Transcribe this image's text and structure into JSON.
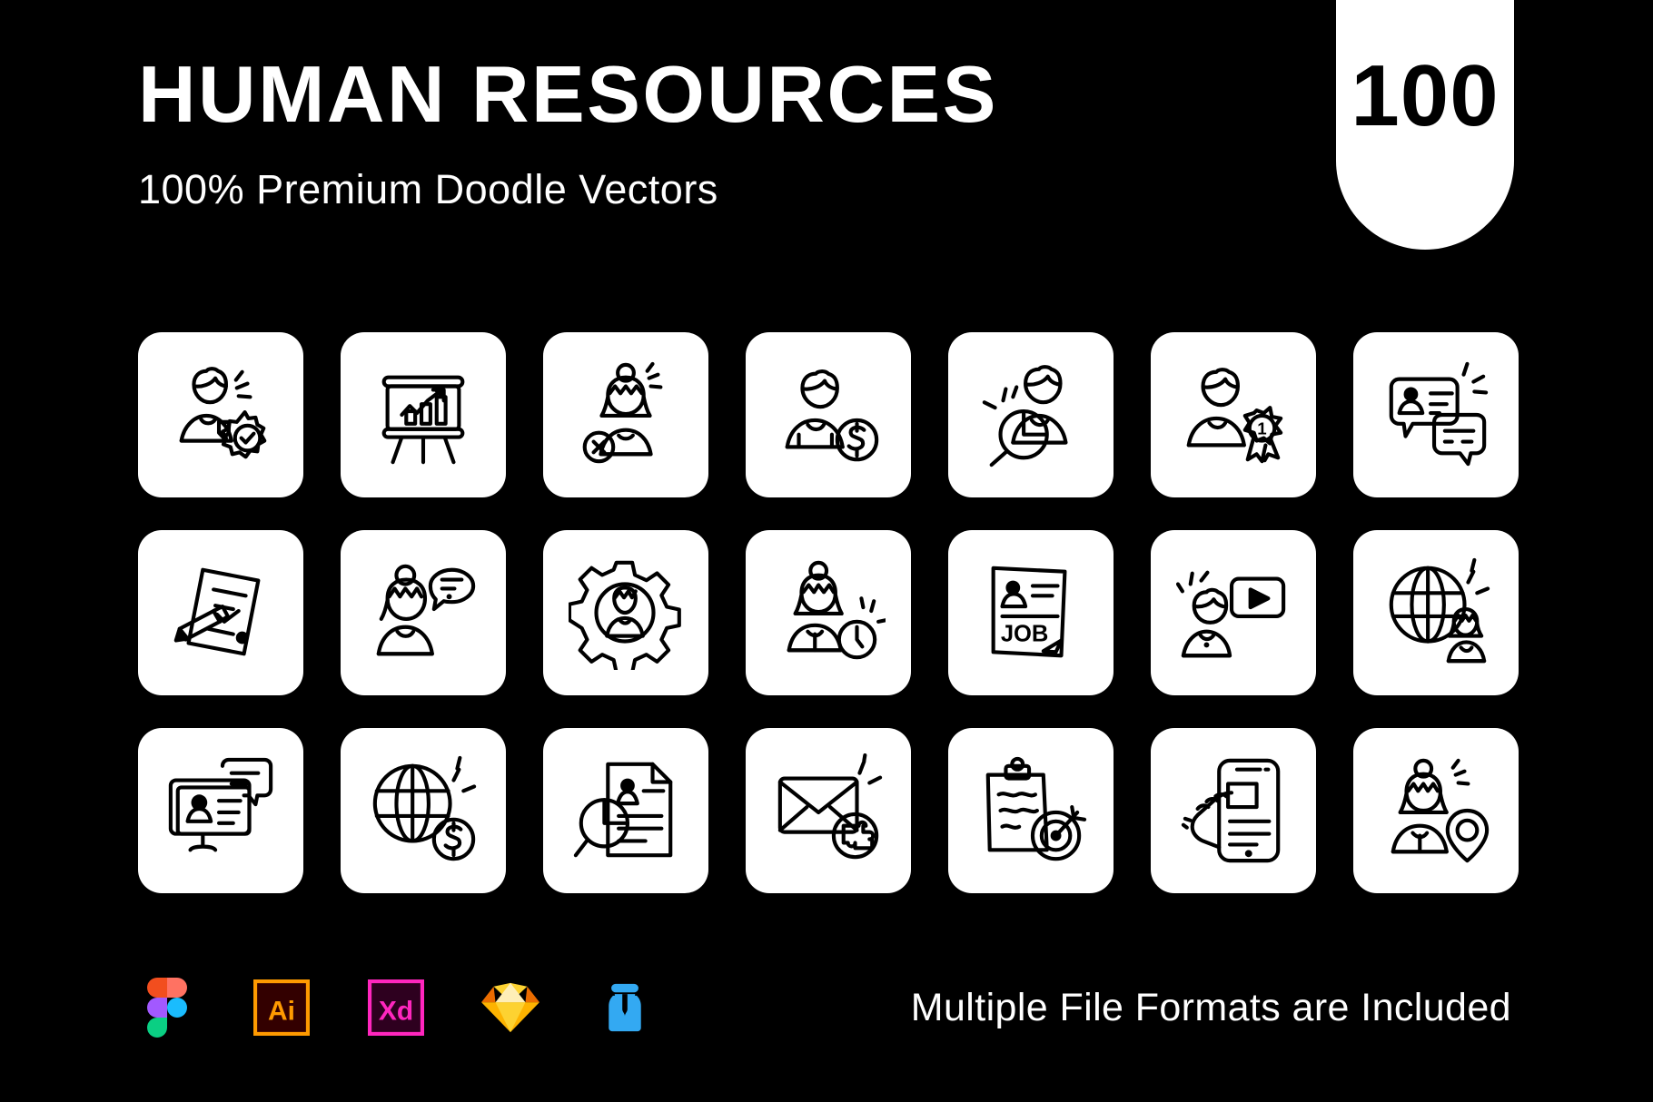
{
  "badge": {
    "count": "100"
  },
  "header": {
    "title": "HUMAN RESOURCES",
    "subtitle": "100% Premium Doodle Vectors"
  },
  "colors": {
    "background": "#000000",
    "tile": "#ffffff",
    "stroke": "#000000",
    "text": "#ffffff",
    "figma_red": "#f24e1e",
    "figma_orange": "#ff7262",
    "figma_purple": "#a259ff",
    "figma_blue": "#1abcfe",
    "figma_green": "#0acf83",
    "illustrator_orange": "#ff9a00",
    "illustrator_bg": "#330000",
    "xd_pink": "#ff26be",
    "xd_bg": "#2e001f",
    "sketch_yellow": "#fdb300",
    "sketch_light": "#fdd231",
    "sketch_cream": "#feeeb7",
    "sketch_orange": "#ea6c00",
    "iconjar_blue": "#33a9f2"
  },
  "grid": {
    "rows": 3,
    "columns": 7,
    "icons": [
      {
        "id": "employee-management",
        "label": "Employee Management",
        "name": "person-gear-check-icon"
      },
      {
        "id": "presentation-chart",
        "label": "Business Presentation",
        "name": "presentation-board-chart-icon"
      },
      {
        "id": "employee-reject",
        "label": "Employee Rejected",
        "name": "person-remove-icon"
      },
      {
        "id": "employee-salary",
        "label": "Employee Salary",
        "name": "person-dollar-icon"
      },
      {
        "id": "candidate-search",
        "label": "Candidate Search",
        "name": "person-magnifier-icon"
      },
      {
        "id": "best-employee",
        "label": "Best Employee Award",
        "name": "person-award-ribbon-icon"
      },
      {
        "id": "interview-chat",
        "label": "Interview Conversation",
        "name": "chat-bubbles-profile-icon"
      },
      {
        "id": "contract-signing",
        "label": "Contract Signing",
        "name": "document-pencil-sign-icon"
      },
      {
        "id": "employee-feedback",
        "label": "Employee Feedback",
        "name": "person-speech-bubble-icon"
      },
      {
        "id": "hr-settings",
        "label": "HR Settings",
        "name": "gear-person-icon"
      },
      {
        "id": "working-hours",
        "label": "Working Hours",
        "name": "person-clock-icon"
      },
      {
        "id": "job-posting",
        "label": "Job Posting",
        "name": "job-document-icon"
      },
      {
        "id": "video-training",
        "label": "Video Training",
        "name": "person-video-player-icon"
      },
      {
        "id": "global-team",
        "label": "Global Team",
        "name": "globe-person-icon"
      },
      {
        "id": "online-profile",
        "label": "Online Profile",
        "name": "monitor-profile-chat-icon"
      },
      {
        "id": "global-payroll",
        "label": "Global Payroll",
        "name": "globe-dollar-icon"
      },
      {
        "id": "resume-search",
        "label": "Resume Search",
        "name": "magnifier-resume-icon"
      },
      {
        "id": "email-integration",
        "label": "Email Integration",
        "name": "envelope-puzzle-icon"
      },
      {
        "id": "goal-checklist",
        "label": "Goals & Targets",
        "name": "clipboard-target-icon"
      },
      {
        "id": "mobile-apply",
        "label": "Mobile Application",
        "name": "hand-tap-phone-icon"
      },
      {
        "id": "employee-location",
        "label": "Employee Location",
        "name": "person-map-pin-icon"
      }
    ],
    "job_document_text": "JOB",
    "award_rank_text": "1",
    "dollar_symbol": "$",
    "reject_symbol": "×"
  },
  "footer": {
    "note": "Multiple File Formats are Included",
    "formats": [
      {
        "id": "figma",
        "label": "Figma",
        "name": "figma-icon"
      },
      {
        "id": "illustrator",
        "label": "Ai",
        "name": "adobe-illustrator-icon"
      },
      {
        "id": "xd",
        "label": "Xd",
        "name": "adobe-xd-icon"
      },
      {
        "id": "sketch",
        "label": "Sketch",
        "name": "sketch-icon"
      },
      {
        "id": "iconjar",
        "label": "IconJar",
        "name": "iconjar-icon"
      }
    ]
  }
}
